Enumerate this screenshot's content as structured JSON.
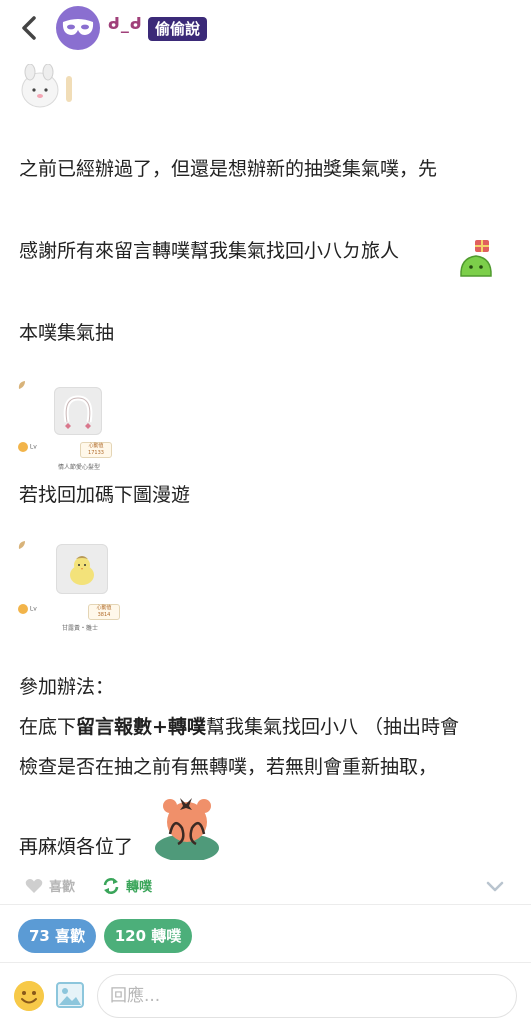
{
  "header": {
    "nickname": "ᑯ_ᑯ",
    "badge": "偷偷說"
  },
  "post": {
    "line1": "之前已經辦過了，但還是想辦新的抽獎集氣噗，先",
    "line2": "感謝所有來留言轉噗幫我集氣找回小八ㄉ旅人",
    "line3": "本噗集氣抽",
    "line4": "若找回加碼下圖漫遊",
    "line5": "參加辦法：",
    "line6_pre": "在底下",
    "line6_bold": "留言報數+轉噗",
    "line6_post": "幫我集氣找回小八 （抽出時會",
    "line7": "檢查是否在抽之前有無轉噗，若無則會重新抽取，",
    "line8": "再麻煩各位了"
  },
  "thumb1": {
    "caption": "情人節愛心髮型",
    "level": "Lv",
    "tag_line1": "心動值",
    "tag_line2": "17133"
  },
  "thumb2": {
    "caption": "甘露黃・雛士",
    "level": "Lv",
    "tag_line1": "心動值",
    "tag_line2": "3814"
  },
  "actions": {
    "like_label": "喜歡",
    "replurk_label": "轉噗"
  },
  "stats": {
    "likes": "73 喜歡",
    "replurks": "120 轉噗"
  },
  "reply": {
    "placeholder": "回應..."
  },
  "colors": {
    "nickname": "#a0407a",
    "badge_bg": "#3b2a78",
    "avatar": "#8a6fd0",
    "like_pill": "#5b9bd5",
    "replurk_pill": "#4caf7a",
    "replurk_icon": "#3aa55a"
  }
}
